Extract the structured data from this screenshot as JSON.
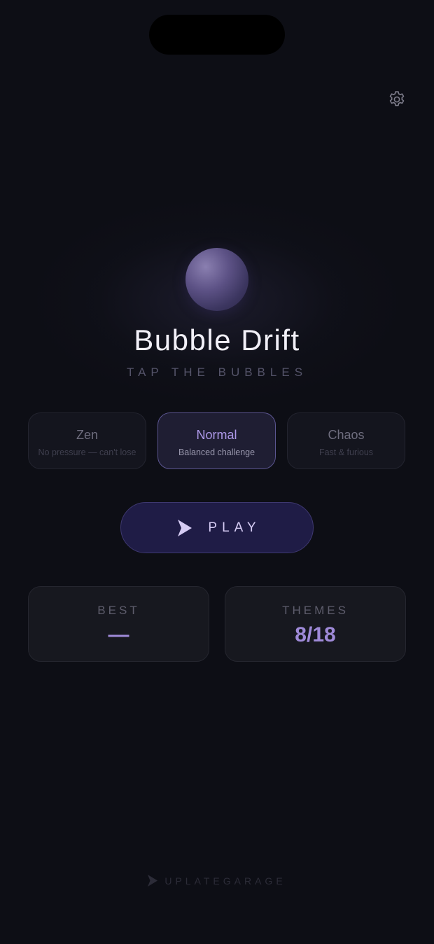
{
  "app": {
    "title": "Bubble Drift",
    "subtitle": "TAP THE BUBBLES"
  },
  "header": {
    "settings_icon": "gear-icon"
  },
  "modes": [
    {
      "name": "Zen",
      "description": "No pressure — can't lose",
      "selected": false
    },
    {
      "name": "Normal",
      "description": "Balanced challenge",
      "selected": true
    },
    {
      "name": "Chaos",
      "description": "Fast & furious",
      "selected": false
    }
  ],
  "play": {
    "label": "PLAY",
    "icon": "play-arrow-icon"
  },
  "stats": {
    "best": {
      "label": "BEST",
      "value": "—"
    },
    "themes": {
      "label": "THEMES",
      "value": "8/18"
    }
  },
  "footer": {
    "brand": "UPLATEGARAGE",
    "icon": "play-arrow-icon"
  },
  "colors": {
    "background": "#0d0e15",
    "accent": "#9f8ad8",
    "play_button": "#1f1c46",
    "orb": "#5d5286"
  }
}
